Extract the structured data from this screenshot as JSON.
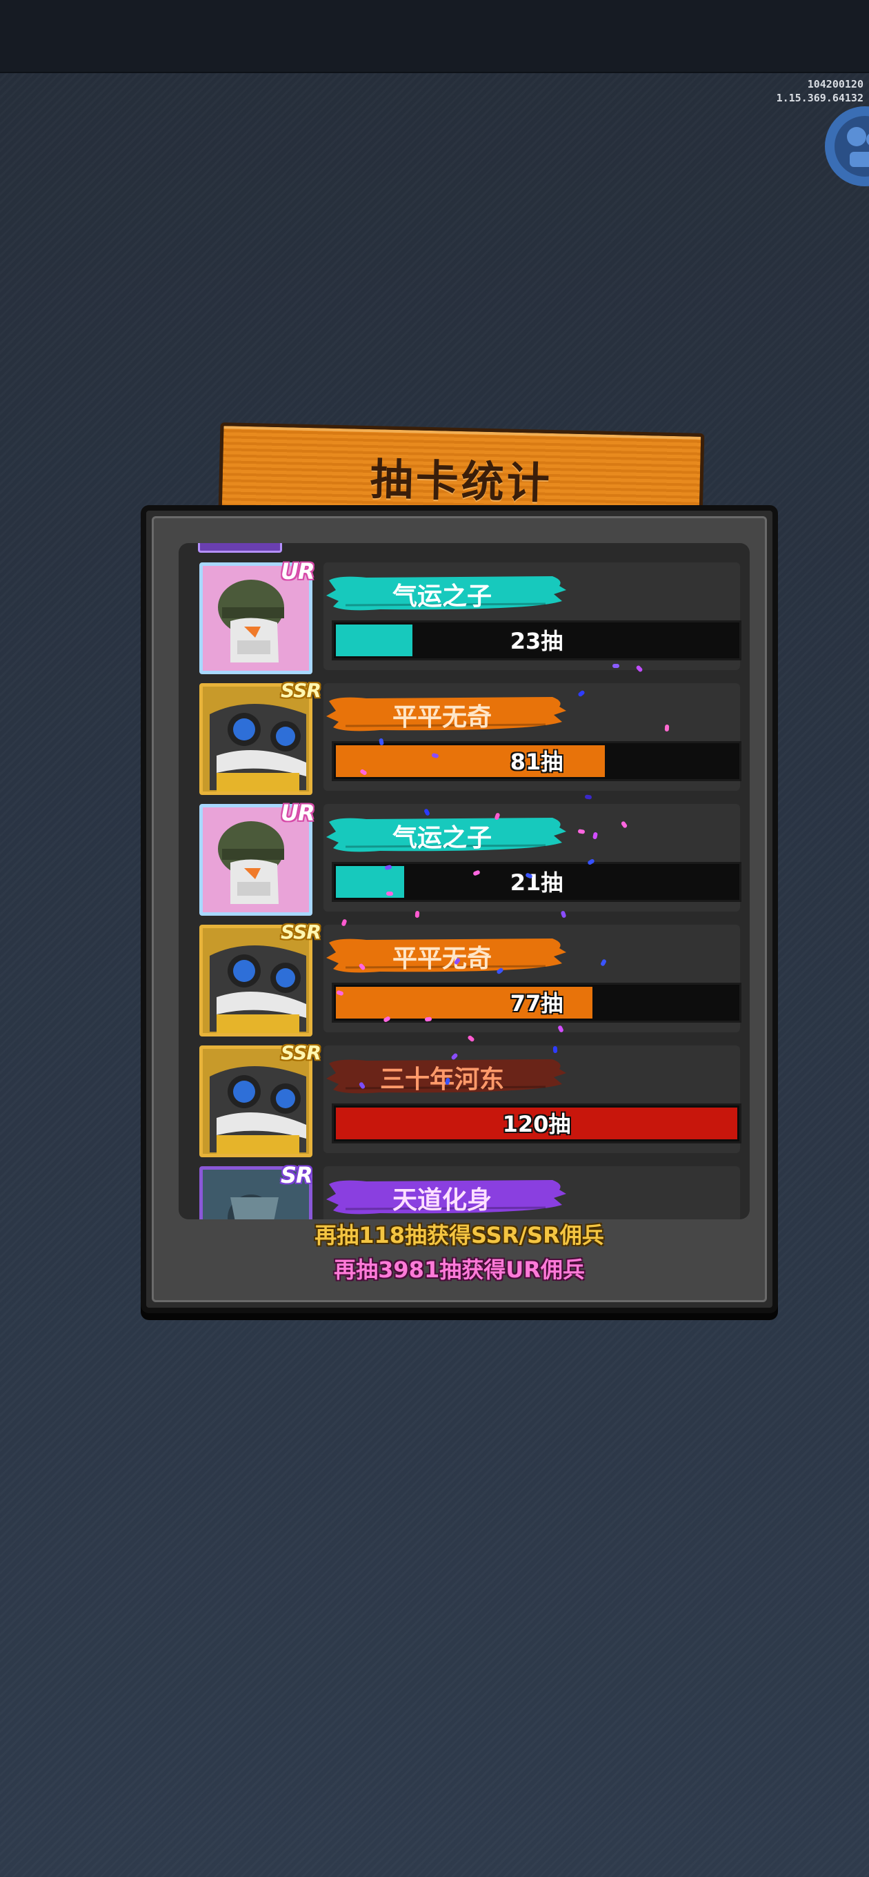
{
  "version": {
    "build_id": "104200120",
    "build_version": "1.15.369.64132"
  },
  "title": "抽卡统计",
  "entries": [
    {
      "rarity": "UR",
      "label": "气运之子",
      "draws": 23,
      "draws_text": "23抽",
      "bar_fill": 0.19,
      "color": "#17c9bd"
    },
    {
      "rarity": "SSR",
      "label": "平平无奇",
      "draws": 81,
      "draws_text": "81抽",
      "bar_fill": 0.67,
      "color": "#e8730a"
    },
    {
      "rarity": "UR",
      "label": "气运之子",
      "draws": 21,
      "draws_text": "21抽",
      "bar_fill": 0.17,
      "color": "#17c9bd"
    },
    {
      "rarity": "SSR",
      "label": "平平无奇",
      "draws": 77,
      "draws_text": "77抽",
      "bar_fill": 0.64,
      "color": "#e8730a"
    },
    {
      "rarity": "SSR",
      "label": "三十年河东",
      "draws": 120,
      "draws_text": "120抽",
      "bar_fill": 1.0,
      "color": "#c8160c"
    },
    {
      "rarity": "SR",
      "label": "天道化身",
      "color": "#8a3fe0"
    }
  ],
  "footer": {
    "ssr_text": "再抽118抽获得SSR/SR佣兵",
    "ur_text": "再抽3981抽获得UR佣兵"
  },
  "colors": {
    "ur_accent": "#17c9bd",
    "ssr_accent": "#e8730a",
    "high_accent": "#c8160c",
    "sr_accent": "#8a3fe0",
    "banner": "#e88a1e"
  }
}
